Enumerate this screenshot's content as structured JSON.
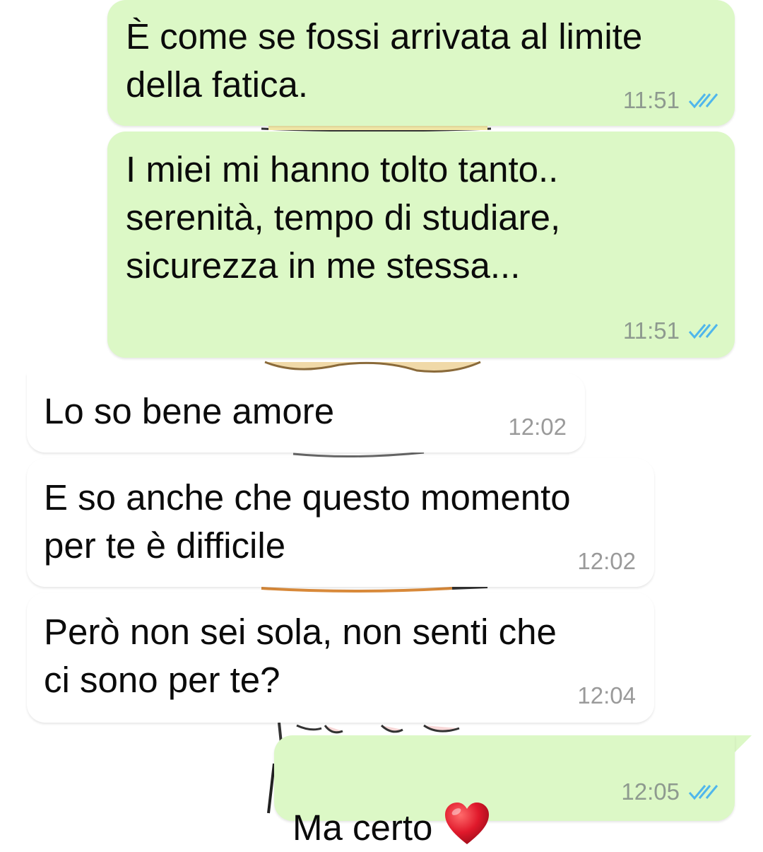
{
  "chat": {
    "messages": [
      {
        "direction": "outgoing",
        "text": "È come se fossi arrivata al limite\ndella fatica.",
        "time": "11:51",
        "status": "read"
      },
      {
        "direction": "outgoing",
        "text": "I miei mi hanno tolto tanto..\nserenità, tempo di studiare,\nsicurezza in me stessa...",
        "time": "11:51",
        "status": "read"
      },
      {
        "direction": "incoming",
        "text": "Lo so bene amore",
        "time": "12:02"
      },
      {
        "direction": "incoming",
        "text": "E so anche che questo momento\nper te è difficile",
        "time": "12:02"
      },
      {
        "direction": "incoming",
        "text": "Però non sei sola, non senti che\nci sono per te?",
        "time": "12:04"
      },
      {
        "direction": "outgoing",
        "text": "Ma certo",
        "emoji": "heart-icon",
        "time": "12:05",
        "status": "read"
      }
    ]
  },
  "colors": {
    "outgoing_bubble": "#dcf8c6",
    "incoming_bubble": "#ffffff",
    "read_ticks": "#4fb6ec",
    "heart": "#e0192b"
  }
}
